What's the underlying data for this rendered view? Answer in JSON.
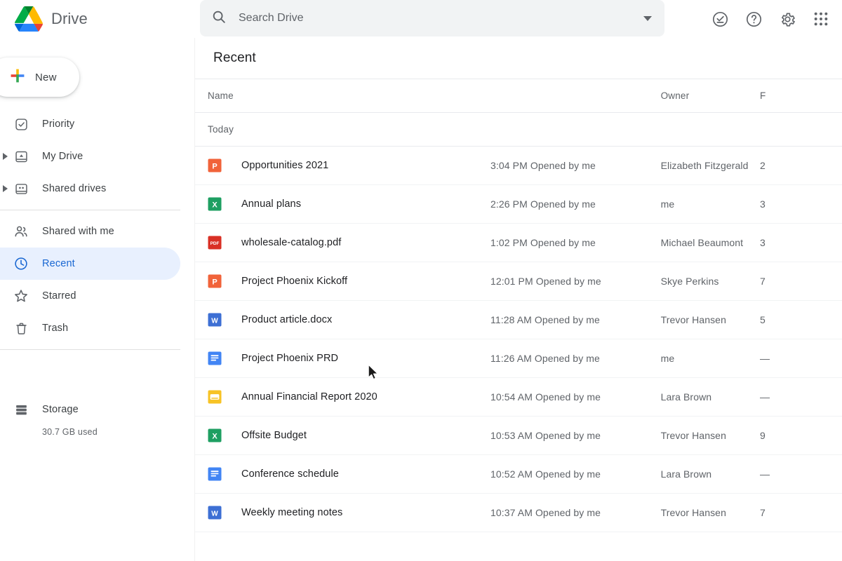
{
  "app": {
    "brand_title": "Drive",
    "logo_icon": "google-drive-logo"
  },
  "search": {
    "placeholder": "Search Drive",
    "value": "",
    "icon": "search-icon",
    "options_icon": "chevron-down-icon"
  },
  "topbar_icons": [
    {
      "name": "tasks-icon",
      "label": "Tasks"
    },
    {
      "name": "help-icon",
      "label": "Support"
    },
    {
      "name": "gear-icon",
      "label": "Settings"
    },
    {
      "name": "apps-grid-icon",
      "label": "Google apps"
    }
  ],
  "sidebar": {
    "new_button": {
      "label": "New",
      "icon": "plus-icon"
    },
    "items": [
      {
        "label": "Priority",
        "icon": "priority-check-icon",
        "expandable": false,
        "active": false
      },
      {
        "label": "My Drive",
        "icon": "my-drive-icon",
        "expandable": true,
        "active": false
      },
      {
        "label": "Shared drives",
        "icon": "shared-drives-icon",
        "expandable": true,
        "active": false
      },
      {
        "label": "Shared with me",
        "icon": "people-icon",
        "expandable": false,
        "active": false
      },
      {
        "label": "Recent",
        "icon": "clock-icon",
        "expandable": false,
        "active": true
      },
      {
        "label": "Starred",
        "icon": "star-icon",
        "expandable": false,
        "active": false
      },
      {
        "label": "Trash",
        "icon": "trash-icon",
        "expandable": false,
        "active": false
      }
    ],
    "storage": {
      "label": "Storage",
      "icon": "storage-icon",
      "used": "30.7 GB used"
    }
  },
  "main": {
    "title": "Recent",
    "columns": {
      "name": "Name",
      "owner": "Owner",
      "size": "F"
    },
    "group_label": "Today",
    "files": [
      {
        "name": "Opportunities 2021",
        "icon": "google-slides-icon",
        "meta": "3:04 PM Opened by me",
        "owner": "Elizabeth Fitzgerald",
        "size": "2"
      },
      {
        "name": "Annual plans",
        "icon": "google-sheets-icon",
        "meta": "2:26 PM Opened by me",
        "owner": "me",
        "size": "3"
      },
      {
        "name": "wholesale-catalog.pdf",
        "icon": "pdf-icon",
        "meta": "1:02 PM Opened by me",
        "owner": "Michael Beaumont",
        "size": "3"
      },
      {
        "name": "Project Phoenix Kickoff",
        "icon": "google-slides-icon",
        "meta": "12:01 PM Opened by me",
        "owner": "Skye Perkins",
        "size": "7"
      },
      {
        "name": "Product article.docx",
        "icon": "word-docx-icon",
        "meta": "11:28 AM Opened by me",
        "owner": "Trevor Hansen",
        "size": "5"
      },
      {
        "name": "Project Phoenix PRD",
        "icon": "google-docs-icon",
        "meta": "11:26 AM Opened by me",
        "owner": "me",
        "size": "—"
      },
      {
        "name": "Annual Financial Report 2020",
        "icon": "google-forms-icon",
        "meta": "10:54 AM Opened by me",
        "owner": "Lara Brown",
        "size": "—"
      },
      {
        "name": "Offsite Budget",
        "icon": "google-sheets-icon",
        "meta": "10:53 AM Opened by me",
        "owner": "Trevor Hansen",
        "size": "9"
      },
      {
        "name": "Conference schedule",
        "icon": "google-docs-icon",
        "meta": "10:52 AM Opened by me",
        "owner": "Lara Brown",
        "size": "—"
      },
      {
        "name": "Weekly meeting notes",
        "icon": "word-docx-icon",
        "meta": "10:37 AM Opened by me",
        "owner": "Trevor Hansen",
        "size": "7"
      }
    ]
  },
  "colors": {
    "accent_blue": "#1967d2",
    "active_bg": "#e8f0fe",
    "text_primary": "#202124",
    "text_secondary": "#5f6368",
    "search_bg": "#f1f3f4",
    "slides_orange": "#f1633a",
    "sheets_green": "#1e9f62",
    "pdf_red": "#d93025",
    "word_blue": "#3d6fd4",
    "docs_blue": "#4285f4",
    "forms_yellow": "#f7c325"
  }
}
